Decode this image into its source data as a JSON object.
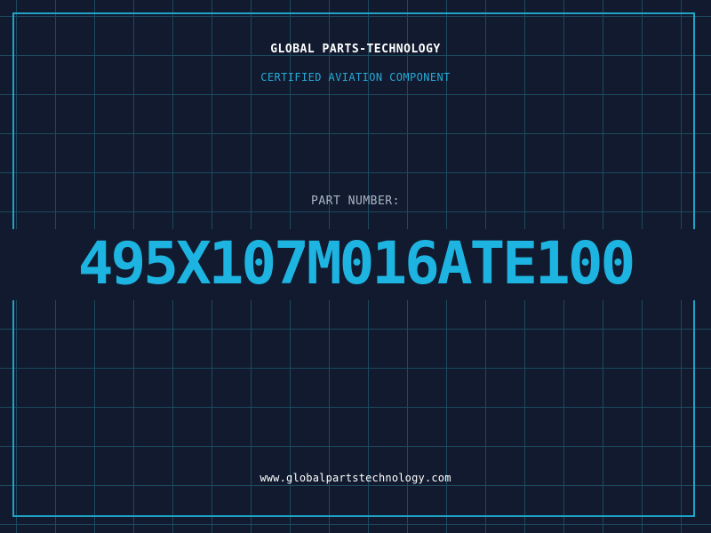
{
  "brand": {
    "name": "GLOBAL PARTS-TECHNOLOGY",
    "tagline": "CERTIFIED AVIATION COMPONENT"
  },
  "part": {
    "label": "PART NUMBER:",
    "number": "495X107M016ATE100"
  },
  "footer": {
    "website": "www.globalpartstechnology.com"
  },
  "colors": {
    "background": "#111a2e",
    "grid": "#1d4a5e",
    "frame": "#1fa3c7",
    "accent": "#1db4e2"
  }
}
